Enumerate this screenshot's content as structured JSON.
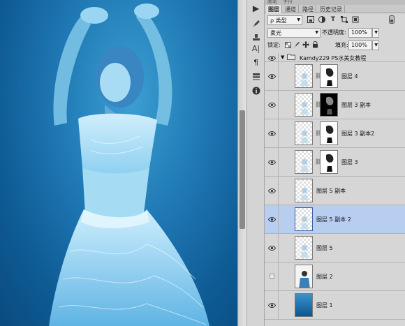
{
  "panel_tabs": {
    "top": [
      "画笔",
      "字符"
    ],
    "main": [
      "图层",
      "通道",
      "路径",
      "历史记录"
    ]
  },
  "filter": {
    "kind_label": "ρ 类型"
  },
  "blend": {
    "mode": "柔光",
    "opacity_label": "不透明度:",
    "opacity": "100%"
  },
  "lock": {
    "label": "锁定:",
    "fill_label": "填充:",
    "fill": "100%"
  },
  "group": {
    "name": "Kamdy229 PS水美女教程"
  },
  "layers": [
    {
      "name": "图层 4",
      "visible": true,
      "has_mask": true
    },
    {
      "name": "图层 3 副本",
      "visible": true,
      "has_mask": true
    },
    {
      "name": "图层 3 副本2",
      "visible": true,
      "has_mask": true
    },
    {
      "name": "图层 3",
      "visible": true,
      "has_mask": true
    },
    {
      "name": "图层 5 副本",
      "visible": true,
      "has_mask": false
    },
    {
      "name": "图层 5 副本 2",
      "visible": true,
      "has_mask": false,
      "selected": true
    },
    {
      "name": "图层 5",
      "visible": true,
      "has_mask": false
    },
    {
      "name": "图层 2",
      "visible": false,
      "has_mask": false
    },
    {
      "name": "图层 1",
      "visible": true,
      "has_mask": false
    }
  ],
  "colors": {
    "canvas_blue": "#1f78b4",
    "selected_row": "#b8cef0",
    "panel_bg": "#d6d6d6"
  }
}
